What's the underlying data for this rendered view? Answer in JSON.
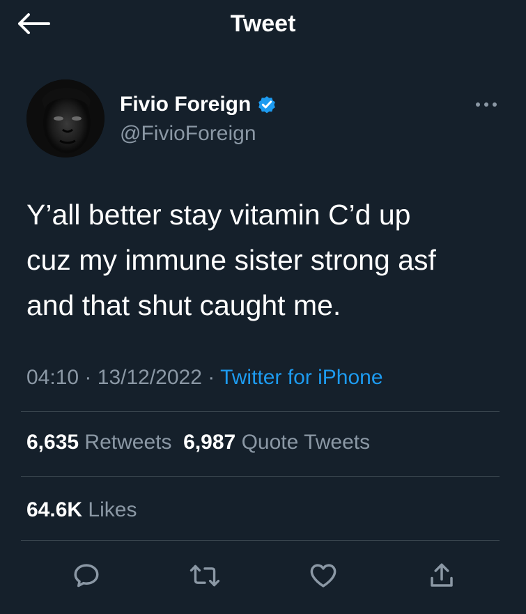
{
  "header": {
    "title": "Tweet",
    "back_icon": "arrow-left-icon"
  },
  "author": {
    "display_name": "Fivio Foreign",
    "handle": "@FivioForeign",
    "verified": true,
    "verified_color": "#1d9bf0"
  },
  "tweet": {
    "text": "Y’all better stay vitamin C’d up\ncuz my immune sister strong asf\nand that shut caught me.",
    "time": "04:10",
    "separator": "·",
    "date": "13/12/2022",
    "source": "Twitter for iPhone"
  },
  "stats": {
    "retweets_count": "6,635",
    "retweets_label": "Retweets",
    "quote_tweets_count": "6,987",
    "quote_tweets_label": "Quote Tweets",
    "likes_count": "64.6K",
    "likes_label": "Likes"
  },
  "actions": {
    "icons": [
      "reply-icon",
      "retweet-icon",
      "like-icon",
      "share-icon"
    ]
  },
  "colors": {
    "background": "#15202b",
    "text_primary": "#ffffff",
    "text_secondary": "#8b98a5",
    "accent": "#1d9bf0",
    "divider": "#38444d"
  }
}
